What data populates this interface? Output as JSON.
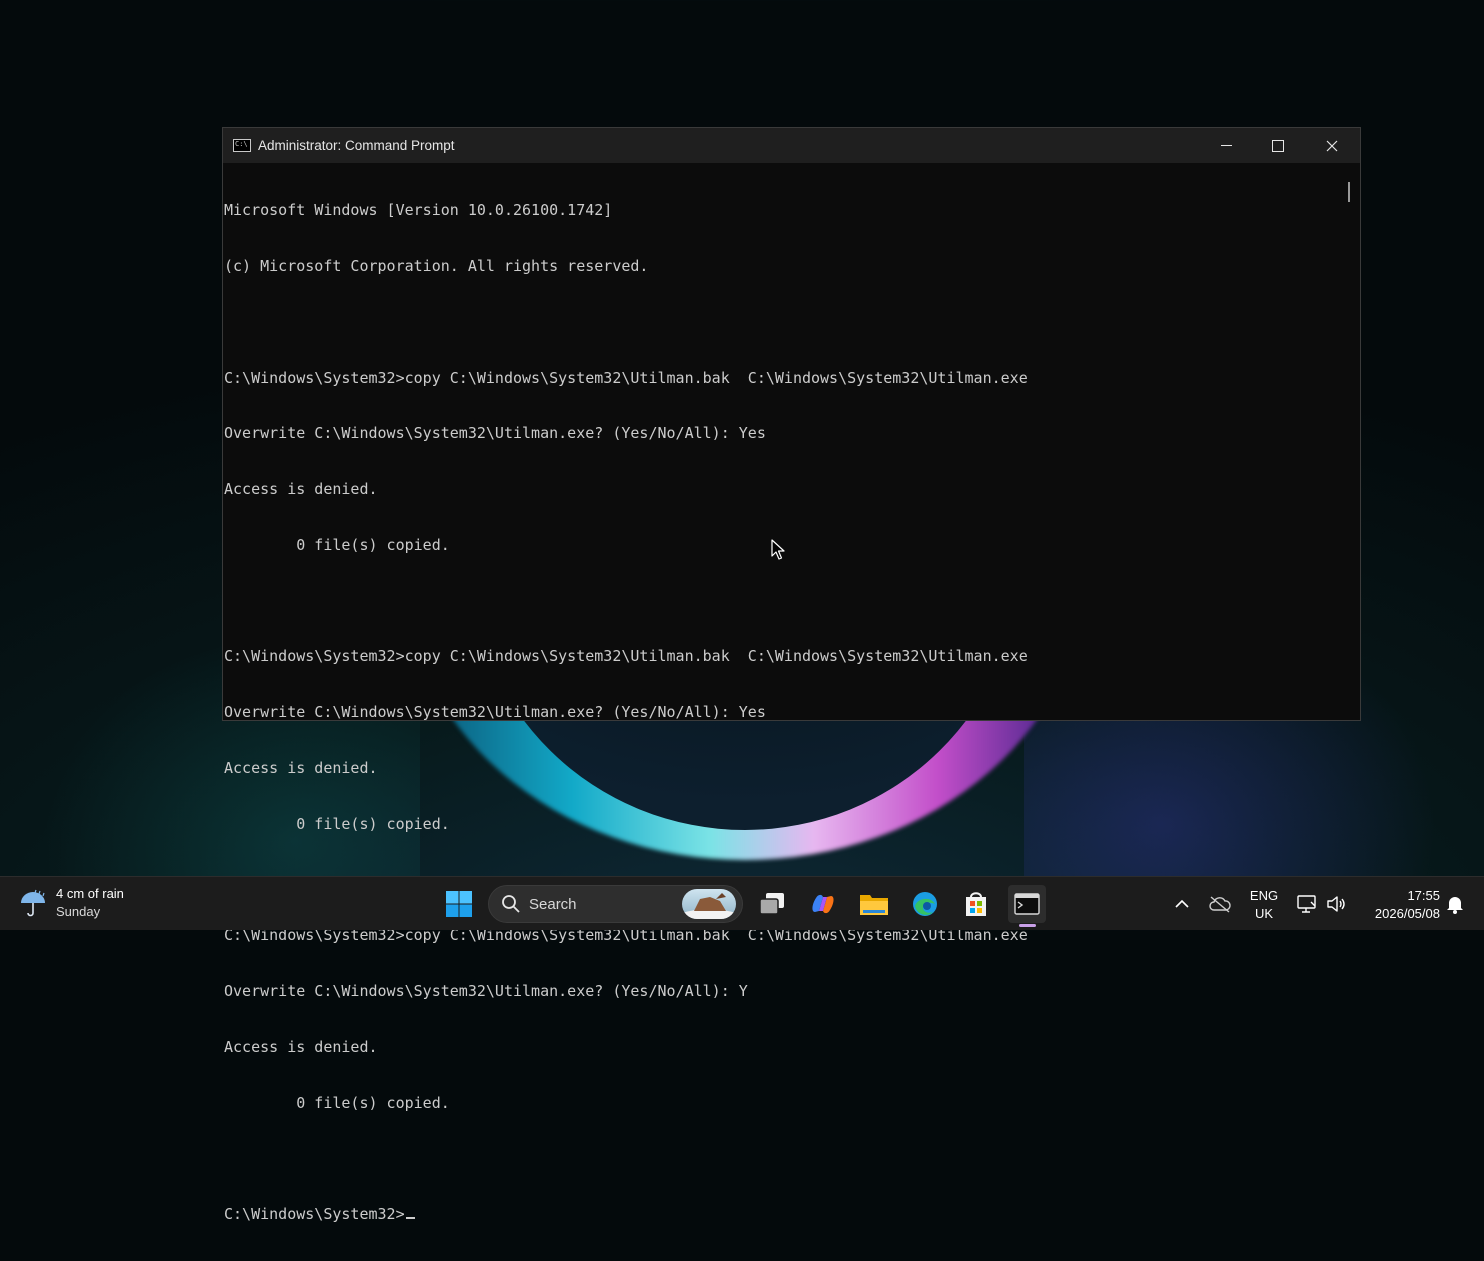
{
  "window": {
    "title": "Administrator: Command Prompt",
    "icon": "cmd-icon",
    "controls": [
      "minimize-icon",
      "maximize-icon",
      "close-icon"
    ]
  },
  "console": {
    "lines": [
      "Microsoft Windows [Version 10.0.26100.1742]",
      "(c) Microsoft Corporation. All rights reserved.",
      "",
      "C:\\Windows\\System32>copy C:\\Windows\\System32\\Utilman.bak  C:\\Windows\\System32\\Utilman.exe",
      "Overwrite C:\\Windows\\System32\\Utilman.exe? (Yes/No/All): Yes",
      "Access is denied.",
      "        0 file(s) copied.",
      "",
      "C:\\Windows\\System32>copy C:\\Windows\\System32\\Utilman.bak  C:\\Windows\\System32\\Utilman.exe",
      "Overwrite C:\\Windows\\System32\\Utilman.exe? (Yes/No/All): Yes",
      "Access is denied.",
      "        0 file(s) copied.",
      "",
      "C:\\Windows\\System32>copy C:\\Windows\\System32\\Utilman.bak  C:\\Windows\\System32\\Utilman.exe",
      "Overwrite C:\\Windows\\System32\\Utilman.exe? (Yes/No/All): Y",
      "Access is denied.",
      "        0 file(s) copied.",
      ""
    ],
    "prompt": "C:\\Windows\\System32>"
  },
  "taskbar": {
    "weather": {
      "line1": "4 cm of rain",
      "line2": "Sunday",
      "icon": "rain-umbrella-icon"
    },
    "search": {
      "label": "Search"
    },
    "apps": [
      "start-icon",
      "task-view-icon",
      "copilot-icon",
      "file-explorer-icon",
      "edge-icon",
      "store-icon",
      "terminal-icon"
    ],
    "tray": {
      "lang_line1": "ENG",
      "lang_line2": "UK",
      "time": "17:55",
      "date": "2026/05/08"
    }
  },
  "colors": {
    "console_bg": "#0c0c0c",
    "console_text": "#cccccc",
    "titlebar_bg": "#1f1f1f",
    "taskbar_bg": "#1c1c1c"
  }
}
